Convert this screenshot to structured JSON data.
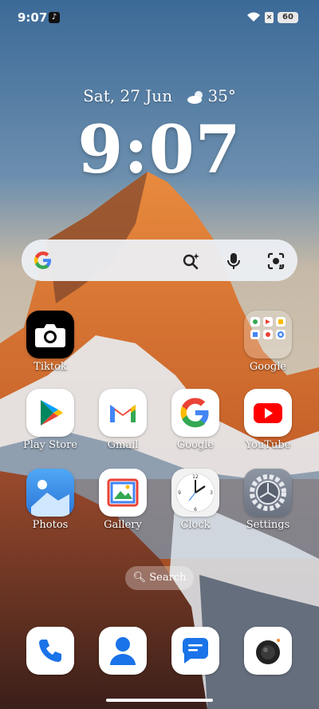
{
  "status": {
    "time": "9:07",
    "notif_icon": "tiktok-icon",
    "sim": "×",
    "battery": "60"
  },
  "widget": {
    "date": "Sat, 27 Jun",
    "weather_icon": "partly-cloudy-icon",
    "temp": "35°",
    "clock": "9:07"
  },
  "search_bar": {
    "icons": [
      "google-icon",
      "ai-search-icon",
      "mic-icon",
      "lens-icon"
    ]
  },
  "apps_row1": [
    {
      "label": "Tiktok"
    },
    {
      "label": "Google"
    }
  ],
  "apps_row2": [
    {
      "label": "Play Store"
    },
    {
      "label": "Gmail"
    },
    {
      "label": "Google"
    },
    {
      "label": "YouTube"
    }
  ],
  "apps_row3": [
    {
      "label": "Photos"
    },
    {
      "label": "Gallery"
    },
    {
      "label": "Clock"
    },
    {
      "label": "Settings"
    }
  ],
  "search_pill": {
    "label": "Search"
  },
  "dock": [
    "phone-icon",
    "contacts-icon",
    "messages-icon",
    "camera-icon"
  ],
  "colors": {
    "accent_blue": "#1a73e8",
    "youtube_red": "#ff0000",
    "sky_top": "#3f6f9c",
    "sky_bottom": "#cdbfae"
  }
}
